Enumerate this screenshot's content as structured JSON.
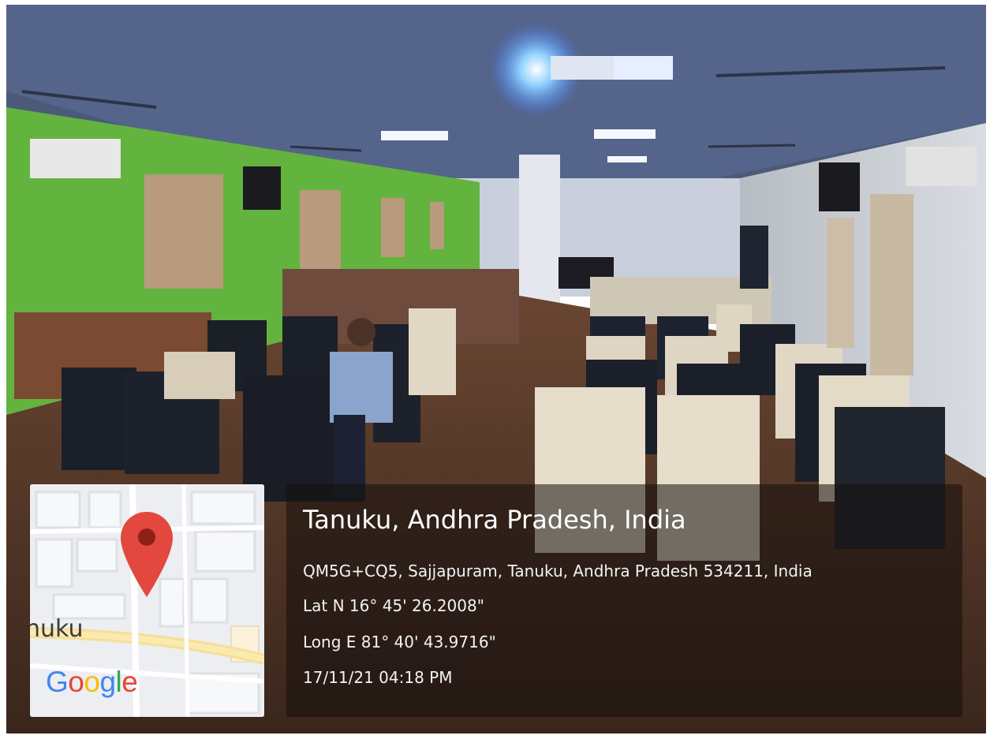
{
  "map": {
    "place_label": "nuku",
    "logo": {
      "letters": [
        "G",
        "o",
        "o",
        "g",
        "l",
        "e"
      ],
      "colors": [
        "#4285F4",
        "#EA4335",
        "#FBBC05",
        "#4285F4",
        "#34A853",
        "#EA4335"
      ]
    },
    "pin_color": "#E2483D"
  },
  "location": {
    "title": "Tanuku, Andhra Pradesh, India",
    "address": "QM5G+CQ5, Sajjapuram, Tanuku, Andhra Pradesh 534211, India",
    "latitude": "Lat N 16° 45' 26.2008\"",
    "longitude": "Long E 81° 40' 43.9716\"",
    "timestamp": "17/11/21 04:18 PM"
  }
}
